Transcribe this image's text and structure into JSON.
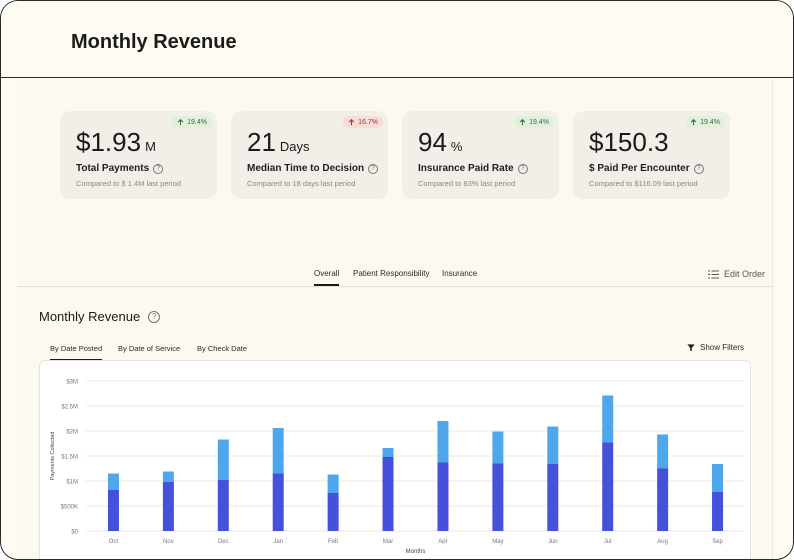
{
  "header": {
    "title": "Monthly Revenue"
  },
  "kpis": [
    {
      "value": "$1.93",
      "unit": "M",
      "label": "Total Payments",
      "compare": "Compared to $ 1.4M last period",
      "change": "19.4%",
      "direction": "up"
    },
    {
      "value": "21",
      "unit": "Days",
      "label": "Median Time to Decision",
      "compare": "Compared to 18 days last period",
      "change": "16.7%",
      "direction": "down"
    },
    {
      "value": "94",
      "unit": "%",
      "label": "Insurance Paid Rate",
      "compare": "Compared to 83% last period",
      "change": "19.4%",
      "direction": "up"
    },
    {
      "value": "$150.3",
      "unit": "",
      "label": "$ Paid Per Encounter",
      "compare": "Compared to $116.09 last period",
      "change": "19.4%",
      "direction": "up"
    }
  ],
  "main_tabs": [
    {
      "label": "Overall",
      "active": true
    },
    {
      "label": "Patient Responsibility",
      "active": false
    },
    {
      "label": "Insurance",
      "active": false
    }
  ],
  "edit_order": {
    "label": "Edit Order",
    "icon": "list-icon"
  },
  "section": {
    "title": "Monthly Revenue"
  },
  "sub_tabs": [
    {
      "label": "By Date Posted",
      "active": true
    },
    {
      "label": "By Date of Service",
      "active": false
    },
    {
      "label": "By Check Date",
      "active": false
    }
  ],
  "show_filters": {
    "label": "Show Filters",
    "icon": "filter-icon"
  },
  "colors": {
    "dark_bar": "#4651db",
    "light_bar": "#4ea7ec",
    "up": "#3d6b3a",
    "down": "#9a3a30"
  },
  "chart_data": {
    "type": "bar",
    "stacked": true,
    "categories": [
      "Oct",
      "Nov",
      "Dec",
      "Jan",
      "Feb",
      "Mar",
      "Apr",
      "May",
      "Jun",
      "Jul",
      "Aug",
      "Sep"
    ],
    "series": [
      {
        "values": [
          820000,
          980000,
          1020000,
          1150000,
          760000,
          1480000,
          1370000,
          1350000,
          1340000,
          1770000,
          1250000,
          780000
        ]
      },
      {
        "values": [
          330000,
          210000,
          810000,
          910000,
          370000,
          180000,
          830000,
          640000,
          750000,
          940000,
          680000,
          560000
        ]
      }
    ],
    "xlabel": "Months",
    "ylabel": "Payments Collected",
    "ytick_labels": [
      "$0",
      "$500K",
      "$1M",
      "$1.5M",
      "$2M",
      "$2.5M",
      "$3M"
    ],
    "ylim": [
      0,
      3000000
    ],
    "grid": true
  }
}
